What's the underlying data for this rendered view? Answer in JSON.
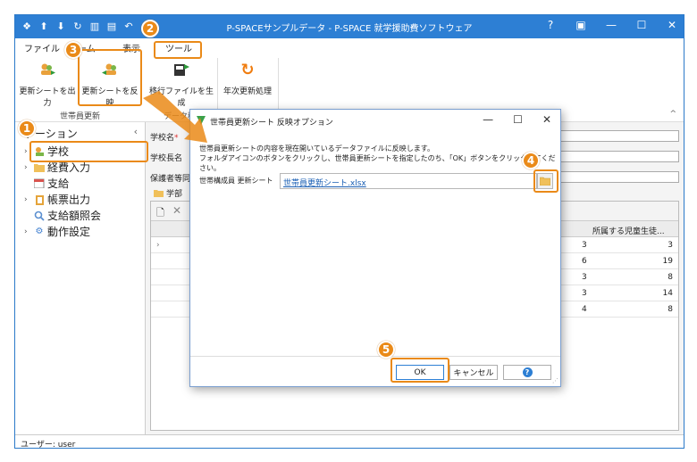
{
  "window": {
    "title": "P-SPACEサンプルデータ - P-SPACE 就学援助費ソフトウェア",
    "help": "?"
  },
  "menu": {
    "file": "ファイル",
    "home": "ーム",
    "view": "表示",
    "tools": "ツール"
  },
  "ribbon": {
    "buttons": [
      {
        "label": "更新シートを出力"
      },
      {
        "label": "更新シートを反映"
      },
      {
        "label": "移行ファイルを生成"
      },
      {
        "label": "年次更新処理"
      }
    ],
    "group_label": "世帯員更新"
  },
  "tab_fragment": "データ移",
  "nav": {
    "header": "ゲーション",
    "items": [
      {
        "label": "学校",
        "has_children": true
      },
      {
        "label": "経費入力",
        "has_children": true
      },
      {
        "label": "支給",
        "has_children": false
      },
      {
        "label": "帳票出力",
        "has_children": true
      },
      {
        "label": "支給額照会",
        "has_children": false
      },
      {
        "label": "動作設定",
        "has_children": true
      }
    ]
  },
  "main": {
    "school_name_label": "学校名",
    "principal_label": "学校長名",
    "guardian_label": "保護者等同",
    "tab_label": "学部",
    "column_header": "所属する児童生徒...",
    "rows": [
      {
        "a": "3",
        "b": "3"
      },
      {
        "a": "6",
        "b": "19"
      },
      {
        "a": "3",
        "b": "8"
      },
      {
        "a": "3",
        "b": "14"
      },
      {
        "a": "4",
        "b": "8"
      }
    ]
  },
  "status": {
    "user": "ユーザー: user"
  },
  "dialog": {
    "title": "世帯員更新シート 反映オプション",
    "message_line1": "世帯員更新シートの内容を現在開いているデータファイルに反映します。",
    "message_line2": "フォルダアイコンのボタンをクリックし、世帯員更新シートを指定したのち、「OK」ボタンをクリックしてください。",
    "field_label": "世帯構成員 更新シート",
    "field_value": "世帯員更新シート.xlsx",
    "ok": "OK",
    "cancel": "キャンセル",
    "help": "?"
  },
  "callouts": [
    "1",
    "2",
    "3",
    "4",
    "5"
  ],
  "colors": {
    "accent": "#2d7fd4",
    "callout": "#ea8a18"
  }
}
